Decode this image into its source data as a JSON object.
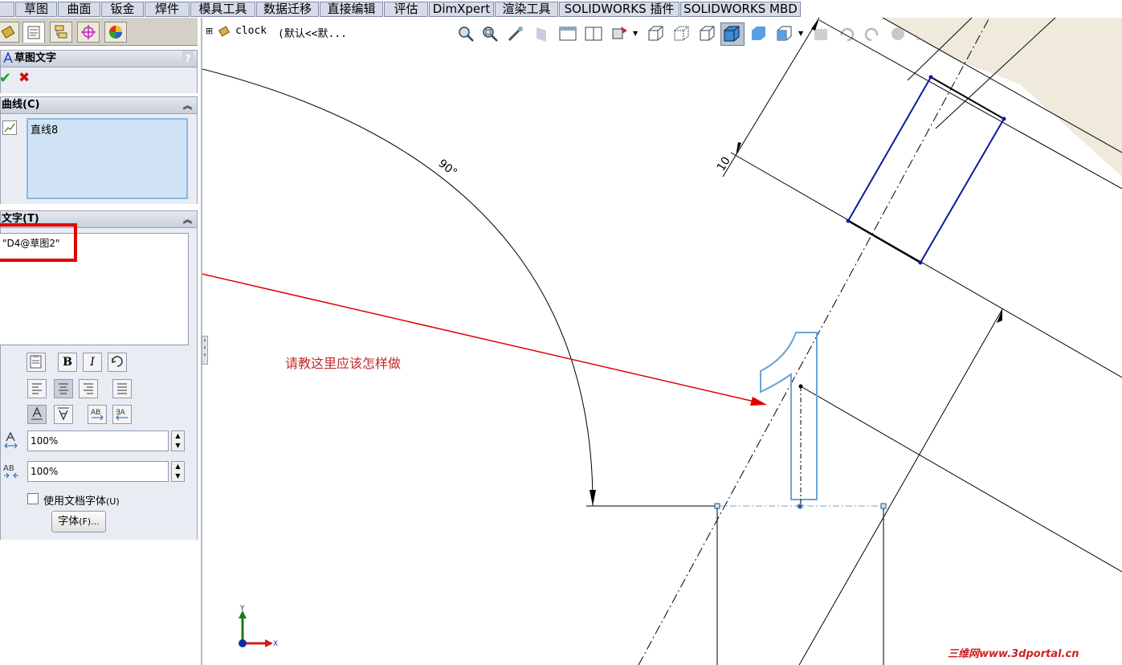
{
  "tabs": [
    "草图",
    "曲面",
    "钣金",
    "焊件",
    "模具工具",
    "数据迁移",
    "直接编辑",
    "评估",
    "DimXpert",
    "渲染工具",
    "SOLIDWORKS 插件",
    "SOLIDWORKS MBD"
  ],
  "tree": {
    "expander": "⊞",
    "part_name": "clock",
    "config": "(默认<<默..."
  },
  "property_manager": {
    "title": "草图文字",
    "help": "?",
    "ok_glyph": "✔",
    "cancel_glyph": "✖",
    "curves_section": {
      "header": "曲线(C)",
      "item": "直线8"
    },
    "text_section": {
      "header": "文字(T)",
      "value": "\"D4@草图2\""
    },
    "format_buttons": {
      "bold": "B",
      "italic": "I"
    },
    "width_factor": "100%",
    "spacing": "100%",
    "use_doc_font_label": "使用文档字体",
    "use_doc_font_shortcut": "(U)",
    "use_doc_font_checked": false,
    "font_button": "字体",
    "font_button_shortcut": "(F)..."
  },
  "canvas": {
    "annotation": "请教这里应该怎样做",
    "dim_angle": "90°",
    "dim_length": "10",
    "sketch_text_glyph": "1",
    "axis_y": "Y",
    "axis_x": "X",
    "watermark": "三维网www.3dportal.cn"
  },
  "colors": {
    "accent_red": "#e00000",
    "annotation_red": "#c0282a",
    "sketch_blue": "#0a1aa0",
    "preview_blue": "#6aa4d6",
    "panel_bg": "#e9edf3",
    "selection_bg": "#cfe3f5"
  }
}
